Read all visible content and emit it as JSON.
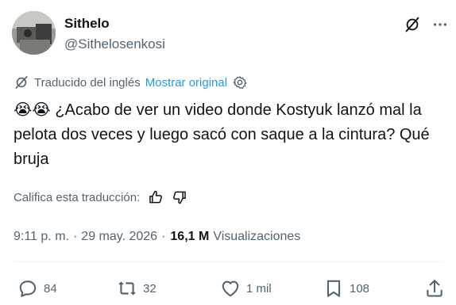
{
  "author": {
    "display_name": "Sithelo",
    "handle": "@Sithelosenkosi"
  },
  "translation": {
    "label": "Traducido del inglés",
    "show_original": "Mostrar original"
  },
  "tweet": {
    "emojis": "😭😭",
    "text": "¿Acabo de ver un video donde Kostyuk lanzó mal la pelota dos veces y luego sacó con saque a la cintura? Qué bruja"
  },
  "rating": {
    "label": "Califica esta traducción:"
  },
  "meta": {
    "time": "9:11 p. m.",
    "separator": "·",
    "date": "29 may. 2026",
    "views_count": "16,1 M",
    "views_label": "Visualizaciones"
  },
  "actions": {
    "replies": "84",
    "reposts": "32",
    "likes": "1 mil",
    "bookmarks": "108"
  },
  "colors": {
    "text": "#0f1419",
    "secondary": "#536471",
    "link": "#1d9bf0"
  }
}
